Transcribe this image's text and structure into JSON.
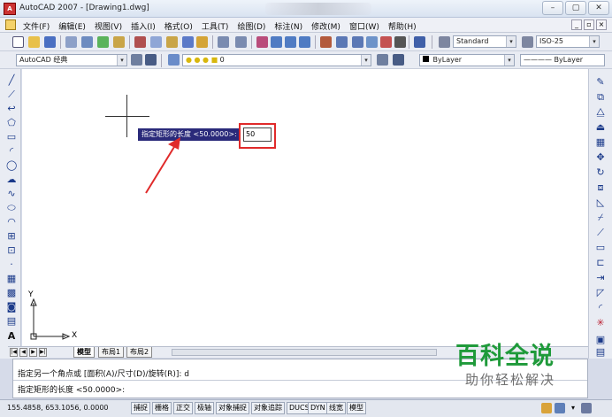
{
  "window": {
    "title": "AutoCAD 2007 - [Drawing1.dwg]",
    "app_icon_label": "A",
    "controls": [
      "–",
      "▢",
      "✕"
    ]
  },
  "menubar": {
    "items": [
      "文件(F)",
      "编辑(E)",
      "视图(V)",
      "插入(I)",
      "格式(O)",
      "工具(T)",
      "绘图(D)",
      "标注(N)",
      "修改(M)",
      "窗口(W)",
      "帮助(H)"
    ],
    "doc_controls": [
      "_",
      "▫",
      "×"
    ]
  },
  "toolbar": {
    "text_style": "Standard",
    "dim_style": "ISO-25",
    "workspace": "AutoCAD 经典",
    "layer": "0",
    "color": "ByLayer",
    "linetype": "ByLayer"
  },
  "canvas": {
    "prompt_label": "指定矩形的长度 <50.0000>:",
    "prompt_value": "50",
    "ucs_y": "Y",
    "ucs_x": "X"
  },
  "layout_tabs": [
    "模型",
    "布局1",
    "布局2"
  ],
  "command": {
    "line1": "指定另一个角点或 [面积(A)/尺寸(D)/旋转(R)]: d",
    "line2": "指定矩形的长度 <50.0000>:"
  },
  "status": {
    "coords": "155.4858,  653.1056,  0.0000",
    "buttons": [
      "捕捉",
      "栅格",
      "正交",
      "极轴",
      "对象捕捉",
      "对象追踪",
      "DUCS",
      "DYN",
      "线宽",
      "模型"
    ]
  },
  "watermark": {
    "title": "百科全说",
    "subtitle": "助你轻松解决"
  },
  "colors": {
    "highlight": "#e02a2a",
    "tooltip_bg": "#2a2a7a",
    "watermark_green": "#1f9a3a"
  }
}
